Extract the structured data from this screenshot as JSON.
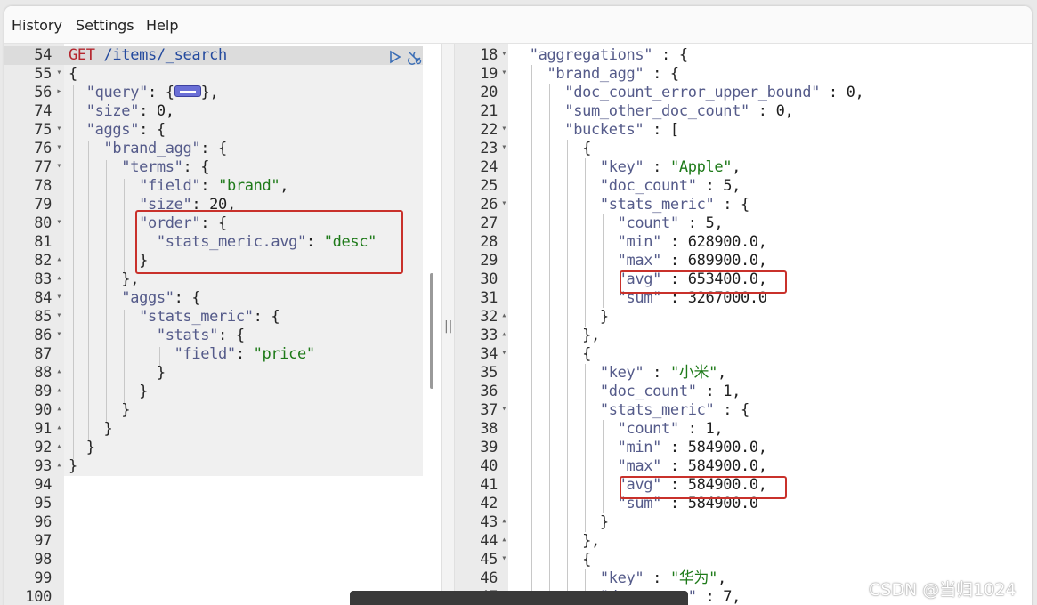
{
  "menu": {
    "history": "History",
    "settings": "Settings",
    "help": "Help"
  },
  "request": {
    "method": "GET",
    "path": " /items/_search",
    "lines": [
      {
        "num": "54",
        "fold": ""
      },
      {
        "num": "55",
        "fold": "▾"
      },
      {
        "num": "56",
        "fold": "▸"
      },
      {
        "num": "74",
        "fold": ""
      },
      {
        "num": "75",
        "fold": "▾"
      },
      {
        "num": "76",
        "fold": "▾"
      },
      {
        "num": "77",
        "fold": "▾"
      },
      {
        "num": "78",
        "fold": ""
      },
      {
        "num": "79",
        "fold": ""
      },
      {
        "num": "80",
        "fold": "▾"
      },
      {
        "num": "81",
        "fold": ""
      },
      {
        "num": "82",
        "fold": "▴"
      },
      {
        "num": "83",
        "fold": "▴"
      },
      {
        "num": "84",
        "fold": "▾"
      },
      {
        "num": "85",
        "fold": "▾"
      },
      {
        "num": "86",
        "fold": "▾"
      },
      {
        "num": "87",
        "fold": ""
      },
      {
        "num": "88",
        "fold": "▴"
      },
      {
        "num": "89",
        "fold": "▴"
      },
      {
        "num": "90",
        "fold": "▴"
      },
      {
        "num": "91",
        "fold": "▴"
      },
      {
        "num": "92",
        "fold": "▴"
      },
      {
        "num": "93",
        "fold": "▴"
      },
      {
        "num": "94",
        "fold": ""
      },
      {
        "num": "95",
        "fold": ""
      },
      {
        "num": "96",
        "fold": ""
      },
      {
        "num": "97",
        "fold": ""
      },
      {
        "num": "98",
        "fold": ""
      },
      {
        "num": "99",
        "fold": ""
      },
      {
        "num": "100",
        "fold": ""
      }
    ],
    "code": [
      [],
      [
        [
          "p",
          "{"
        ]
      ],
      [
        [
          "k",
          "  \"query\""
        ],
        [
          "p",
          ": {"
        ],
        [
          "badge",
          ""
        ],
        [
          "p",
          "},"
        ]
      ],
      [
        [
          "k",
          "  \"size\""
        ],
        [
          "p",
          ": "
        ],
        [
          "n",
          "0"
        ],
        [
          "p",
          ","
        ]
      ],
      [
        [
          "k",
          "  \"aggs\""
        ],
        [
          "p",
          ": {"
        ]
      ],
      [
        [
          "k",
          "    \"brand_agg\""
        ],
        [
          "p",
          ": {"
        ]
      ],
      [
        [
          "k",
          "      \"terms\""
        ],
        [
          "p",
          ": {"
        ]
      ],
      [
        [
          "k",
          "        \"field\""
        ],
        [
          "p",
          ": "
        ],
        [
          "s",
          "\"brand\""
        ],
        [
          "p",
          ","
        ]
      ],
      [
        [
          "k",
          "        \"size\""
        ],
        [
          "p",
          ": "
        ],
        [
          "n",
          "20"
        ],
        [
          "p",
          ","
        ]
      ],
      [
        [
          "k",
          "        \"order\""
        ],
        [
          "p",
          ": {"
        ]
      ],
      [
        [
          "k",
          "          \"stats_meric.avg\""
        ],
        [
          "p",
          ": "
        ],
        [
          "s",
          "\"desc\""
        ]
      ],
      [
        [
          "p",
          "        }"
        ]
      ],
      [
        [
          "p",
          "      },"
        ]
      ],
      [
        [
          "k",
          "      \"aggs\""
        ],
        [
          "p",
          ": {"
        ]
      ],
      [
        [
          "k",
          "        \"stats_meric\""
        ],
        [
          "p",
          ": {"
        ]
      ],
      [
        [
          "k",
          "          \"stats\""
        ],
        [
          "p",
          ": {"
        ]
      ],
      [
        [
          "k",
          "            \"field\""
        ],
        [
          "p",
          ": "
        ],
        [
          "s",
          "\"price\""
        ]
      ],
      [
        [
          "p",
          "          }"
        ]
      ],
      [
        [
          "p",
          "        }"
        ]
      ],
      [
        [
          "p",
          "      }"
        ]
      ],
      [
        [
          "p",
          "    }"
        ]
      ],
      [
        [
          "p",
          "  }"
        ]
      ],
      [
        [
          "p",
          "}"
        ]
      ]
    ]
  },
  "response": {
    "lines": [
      {
        "num": "18",
        "fold": "▾"
      },
      {
        "num": "19",
        "fold": "▾"
      },
      {
        "num": "20",
        "fold": ""
      },
      {
        "num": "21",
        "fold": ""
      },
      {
        "num": "22",
        "fold": "▾"
      },
      {
        "num": "23",
        "fold": "▾"
      },
      {
        "num": "24",
        "fold": ""
      },
      {
        "num": "25",
        "fold": ""
      },
      {
        "num": "26",
        "fold": "▾"
      },
      {
        "num": "27",
        "fold": ""
      },
      {
        "num": "28",
        "fold": ""
      },
      {
        "num": "29",
        "fold": ""
      },
      {
        "num": "30",
        "fold": ""
      },
      {
        "num": "31",
        "fold": ""
      },
      {
        "num": "32",
        "fold": "▴"
      },
      {
        "num": "33",
        "fold": "▴"
      },
      {
        "num": "34",
        "fold": "▾"
      },
      {
        "num": "35",
        "fold": ""
      },
      {
        "num": "36",
        "fold": ""
      },
      {
        "num": "37",
        "fold": "▾"
      },
      {
        "num": "38",
        "fold": ""
      },
      {
        "num": "39",
        "fold": ""
      },
      {
        "num": "40",
        "fold": ""
      },
      {
        "num": "41",
        "fold": ""
      },
      {
        "num": "42",
        "fold": ""
      },
      {
        "num": "43",
        "fold": "▴"
      },
      {
        "num": "44",
        "fold": "▴"
      },
      {
        "num": "45",
        "fold": "▾"
      },
      {
        "num": "46",
        "fold": ""
      },
      {
        "num": "47",
        "fold": ""
      }
    ],
    "code": [
      [
        [
          "k",
          "  \"aggregations\""
        ],
        [
          "p",
          " : {"
        ]
      ],
      [
        [
          "k",
          "    \"brand_agg\""
        ],
        [
          "p",
          " : {"
        ]
      ],
      [
        [
          "k",
          "      \"doc_count_error_upper_bound\""
        ],
        [
          "p",
          " : "
        ],
        [
          "n",
          "0"
        ],
        [
          "p",
          ","
        ]
      ],
      [
        [
          "k",
          "      \"sum_other_doc_count\""
        ],
        [
          "p",
          " : "
        ],
        [
          "n",
          "0"
        ],
        [
          "p",
          ","
        ]
      ],
      [
        [
          "k",
          "      \"buckets\""
        ],
        [
          "p",
          " : ["
        ]
      ],
      [
        [
          "p",
          "        {"
        ]
      ],
      [
        [
          "k",
          "          \"key\""
        ],
        [
          "p",
          " : "
        ],
        [
          "s",
          "\"Apple\""
        ],
        [
          "p",
          ","
        ]
      ],
      [
        [
          "k",
          "          \"doc_count\""
        ],
        [
          "p",
          " : "
        ],
        [
          "n",
          "5"
        ],
        [
          "p",
          ","
        ]
      ],
      [
        [
          "k",
          "          \"stats_meric\""
        ],
        [
          "p",
          " : {"
        ]
      ],
      [
        [
          "k",
          "            \"count\""
        ],
        [
          "p",
          " : "
        ],
        [
          "n",
          "5"
        ],
        [
          "p",
          ","
        ]
      ],
      [
        [
          "k",
          "            \"min\""
        ],
        [
          "p",
          " : "
        ],
        [
          "n",
          "628900.0"
        ],
        [
          "p",
          ","
        ]
      ],
      [
        [
          "k",
          "            \"max\""
        ],
        [
          "p",
          " : "
        ],
        [
          "n",
          "689900.0"
        ],
        [
          "p",
          ","
        ]
      ],
      [
        [
          "k",
          "            \"avg\""
        ],
        [
          "p",
          " : "
        ],
        [
          "n",
          "653400.0"
        ],
        [
          "p",
          ","
        ]
      ],
      [
        [
          "k",
          "            \"sum\""
        ],
        [
          "p",
          " : "
        ],
        [
          "n",
          "3267000.0"
        ]
      ],
      [
        [
          "p",
          "          }"
        ]
      ],
      [
        [
          "p",
          "        },"
        ]
      ],
      [
        [
          "p",
          "        {"
        ]
      ],
      [
        [
          "k",
          "          \"key\""
        ],
        [
          "p",
          " : "
        ],
        [
          "s",
          "\"小米\""
        ],
        [
          "p",
          ","
        ]
      ],
      [
        [
          "k",
          "          \"doc_count\""
        ],
        [
          "p",
          " : "
        ],
        [
          "n",
          "1"
        ],
        [
          "p",
          ","
        ]
      ],
      [
        [
          "k",
          "          \"stats_meric\""
        ],
        [
          "p",
          " : {"
        ]
      ],
      [
        [
          "k",
          "            \"count\""
        ],
        [
          "p",
          " : "
        ],
        [
          "n",
          "1"
        ],
        [
          "p",
          ","
        ]
      ],
      [
        [
          "k",
          "            \"min\""
        ],
        [
          "p",
          " : "
        ],
        [
          "n",
          "584900.0"
        ],
        [
          "p",
          ","
        ]
      ],
      [
        [
          "k",
          "            \"max\""
        ],
        [
          "p",
          " : "
        ],
        [
          "n",
          "584900.0"
        ],
        [
          "p",
          ","
        ]
      ],
      [
        [
          "k",
          "            \"avg\""
        ],
        [
          "p",
          " : "
        ],
        [
          "n",
          "584900.0"
        ],
        [
          "p",
          ","
        ]
      ],
      [
        [
          "k",
          "            \"sum\""
        ],
        [
          "p",
          " : "
        ],
        [
          "n",
          "584900.0"
        ]
      ],
      [
        [
          "p",
          "          }"
        ]
      ],
      [
        [
          "p",
          "        },"
        ]
      ],
      [
        [
          "p",
          "        {"
        ]
      ],
      [
        [
          "k",
          "          \"key\""
        ],
        [
          "p",
          " : "
        ],
        [
          "s",
          "\"华为\""
        ],
        [
          "p",
          ","
        ]
      ],
      [
        [
          "k",
          "          \"doc_count\""
        ],
        [
          "p",
          " : "
        ],
        [
          "n",
          "7"
        ],
        [
          "p",
          ","
        ]
      ]
    ]
  },
  "watermark": "CSDN @当归1024",
  "icons": {
    "run": "play-icon",
    "settings": "wrench-icon",
    "divider": "drag-handle-icon"
  }
}
